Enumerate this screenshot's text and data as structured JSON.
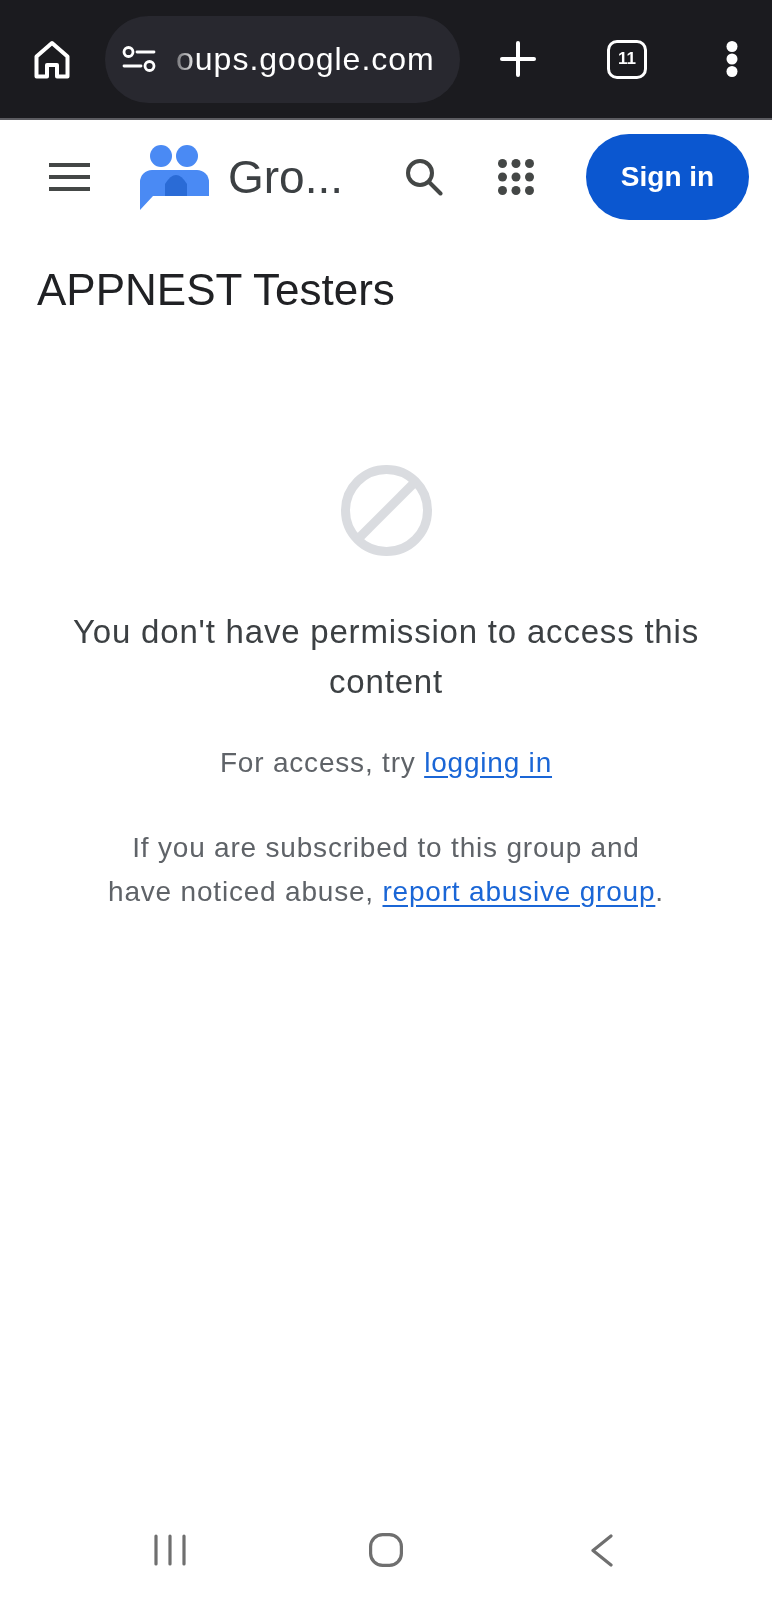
{
  "browser_toolbar": {
    "url": "oups.google.com",
    "tab_count": "11"
  },
  "app_header": {
    "app_name": "Gro...",
    "sign_in_button": "Sign in"
  },
  "group_title": "APPNEST Testers",
  "access_message": {
    "heading": "You don't have permission to access this content",
    "access_hint": {
      "text": "For access, try ",
      "link": "logging in"
    },
    "abuse_note": {
      "text": "If you are subscribed to this group and have noticed abuse, ",
      "link": "report abusive group",
      "text_after": "."
    }
  }
}
